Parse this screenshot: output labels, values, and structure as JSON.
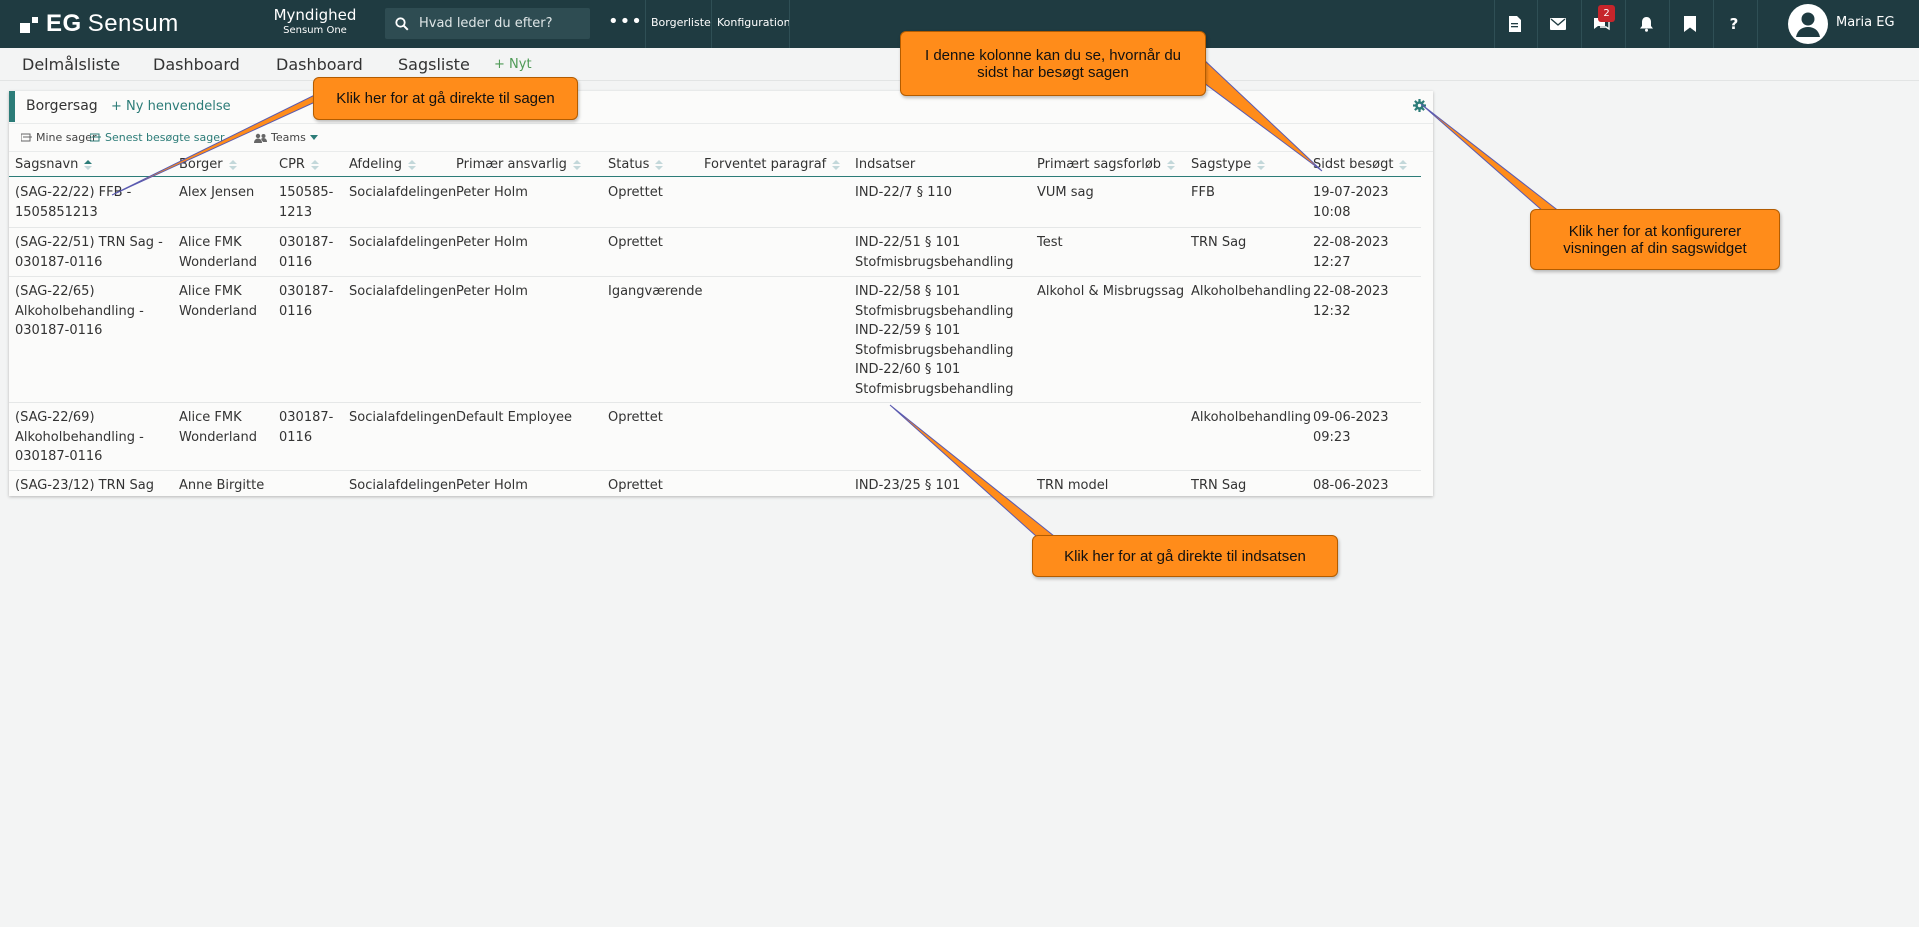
{
  "topbar": {
    "logo": {
      "prefix": "EG",
      "name": "Sensum"
    },
    "authority": {
      "title": "Myndighed",
      "subtitle": "Sensum One"
    },
    "search_placeholder": "Hvad leder du efter?",
    "links": [
      "Borgerliste",
      "Konfiguration"
    ],
    "notification_count": "2",
    "user_name": "Maria EG"
  },
  "subnav": {
    "items": [
      "Delmålsliste",
      "Dashboard",
      "Dashboard",
      "Sagsliste"
    ],
    "new_label": "Nyt"
  },
  "widget": {
    "title": "Borgersag",
    "new_request": "Ny henvendelse",
    "filters": [
      "Mine sager",
      "Senest besøgte sager",
      "Teams"
    ],
    "columns": [
      "Sagsnavn",
      "Borger",
      "CPR",
      "Afdeling",
      "Primær ansvarlig",
      "Status",
      "Forventet paragraf",
      "Indsatser",
      "Primært sagsforløb",
      "Sagstype",
      "Sidst besøgt"
    ],
    "rows": [
      {
        "sagsnavn": [
          "(SAG-22/22) FFB -",
          "1505851213"
        ],
        "borger": [
          "Alex Jensen"
        ],
        "cpr": [
          "150585-",
          "1213"
        ],
        "afdeling": "Socialafdelingen",
        "ansvarlig": "Peter Holm",
        "status": "Oprettet",
        "paragraf": "",
        "indsatser": [
          "IND-22/7 § 110"
        ],
        "forloeb": "VUM sag",
        "sagstype": "FFB",
        "besoegt": [
          "19-07-2023",
          "10:08"
        ]
      },
      {
        "sagsnavn": [
          "(SAG-22/51) TRN Sag -",
          "030187-0116"
        ],
        "borger": [
          "Alice FMK",
          "Wonderland"
        ],
        "cpr": [
          "030187-",
          "0116"
        ],
        "afdeling": "Socialafdelingen",
        "ansvarlig": "Peter Holm",
        "status": "Oprettet",
        "paragraf": "",
        "indsatser": [
          "IND-22/51 § 101",
          "Stofmisbrugsbehandling"
        ],
        "forloeb": "Test",
        "sagstype": "TRN Sag",
        "besoegt": [
          "22-08-2023",
          "12:27"
        ]
      },
      {
        "sagsnavn": [
          "(SAG-22/65)",
          "Alkoholbehandling -",
          "030187-0116"
        ],
        "borger": [
          "Alice FMK",
          "Wonderland"
        ],
        "cpr": [
          "030187-",
          "0116"
        ],
        "afdeling": "Socialafdelingen",
        "ansvarlig": "Peter Holm",
        "status": "Igangværende",
        "paragraf": "",
        "indsatser": [
          "IND-22/58 § 101",
          "Stofmisbrugsbehandling",
          "IND-22/59 § 101",
          "Stofmisbrugsbehandling",
          "IND-22/60 § 101",
          "Stofmisbrugsbehandling"
        ],
        "forloeb": "Alkohol & Misbrugssag",
        "sagstype": "Alkoholbehandling",
        "besoegt": [
          "22-08-2023",
          "12:32"
        ]
      },
      {
        "sagsnavn": [
          "(SAG-22/69)",
          "Alkoholbehandling -",
          "030187-0116"
        ],
        "borger": [
          "Alice FMK",
          "Wonderland"
        ],
        "cpr": [
          "030187-",
          "0116"
        ],
        "afdeling": "Socialafdelingen",
        "ansvarlig": "Default Employee",
        "status": "Oprettet",
        "paragraf": "",
        "indsatser": [],
        "forloeb": "",
        "sagstype": "Alkoholbehandling",
        "besoegt": [
          "09-06-2023",
          "09:23"
        ]
      },
      {
        "sagsnavn": [
          "(SAG-23/12) TRN Sag"
        ],
        "borger": [
          "Anne Birgitte"
        ],
        "cpr": [],
        "afdeling": "Socialafdelingen",
        "ansvarlig": "Peter Holm",
        "status": "Oprettet",
        "paragraf": "",
        "indsatser": [
          "IND-23/25 § 101"
        ],
        "forloeb": "TRN model",
        "sagstype": "TRN Sag",
        "besoegt": [
          "08-06-2023"
        ]
      }
    ]
  },
  "callouts": {
    "case_link": "Klik her for at gå direkte til sagen",
    "last_visited": [
      "I denne kolonne kan du se, hvornår du",
      "sidst har besøgt sagen"
    ],
    "configure": [
      "Klik her for at konfigurerer",
      "visningen af din sagswidget"
    ],
    "intervention": "Klik her for at gå direkte til indsatsen"
  },
  "colors": {
    "topbar": "#1f3b41",
    "accent": "#2c7c78",
    "callout": "#ff8c1a",
    "badge": "#c6252b"
  },
  "icons": [
    "document-icon",
    "mail-icon",
    "chat-icon",
    "bell-icon",
    "bookmark-icon",
    "help-icon",
    "settings-gear-icon",
    "search-icon",
    "user-avatar-icon"
  ]
}
